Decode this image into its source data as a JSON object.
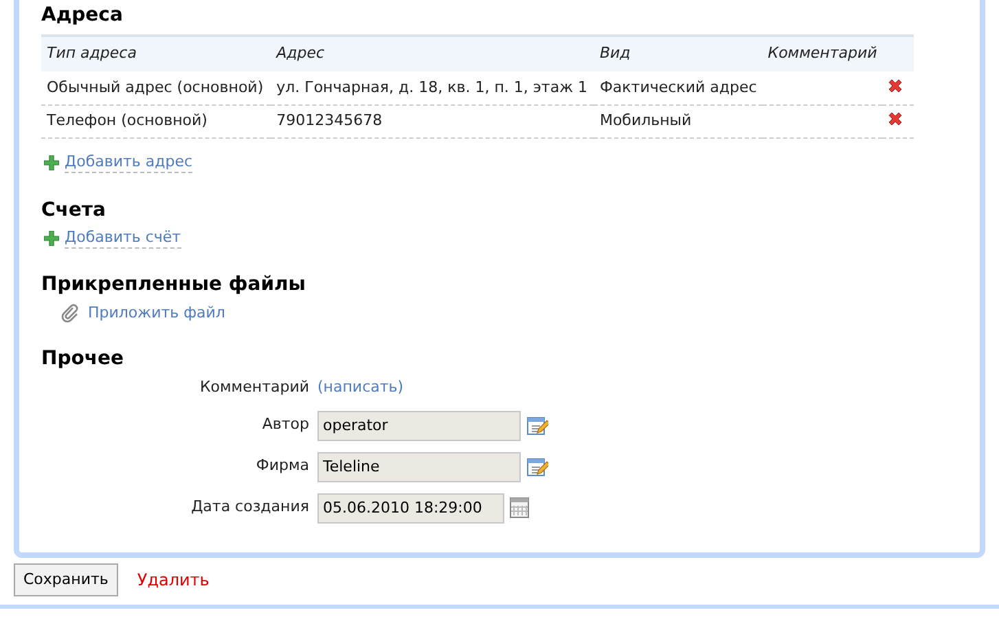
{
  "addresses": {
    "title": "Адреса",
    "columns": [
      "Тип адреса",
      "Адрес",
      "Вид",
      "Комментарий"
    ],
    "rows": [
      {
        "type": "Обычный адрес (основной)",
        "address": "ул. Гончарная, д. 18, кв. 1, п. 1, этаж 1",
        "kind": "Фактический адрес",
        "comment": ""
      },
      {
        "type": "Телефон (основной)",
        "address": "79012345678",
        "kind": "Мобильный",
        "comment": ""
      }
    ],
    "add_link": "Добавить адрес"
  },
  "accounts": {
    "title": "Счета",
    "add_link": "Добавить счёт"
  },
  "files": {
    "title": "Прикрепленные файлы",
    "attach_link": "Приложить файл"
  },
  "other": {
    "title": "Прочее",
    "comment_label": "Комментарий",
    "comment_link": "(написать)",
    "fields": [
      {
        "label": "Автор",
        "value": "operator",
        "kind": "edit"
      },
      {
        "label": "Фирма",
        "value": "Teleline",
        "kind": "edit"
      },
      {
        "label": "Дата создания",
        "value": "05.06.2010 18:29:00",
        "kind": "date"
      }
    ]
  },
  "buttons": {
    "save": "Сохранить",
    "delete": "Удалить"
  }
}
